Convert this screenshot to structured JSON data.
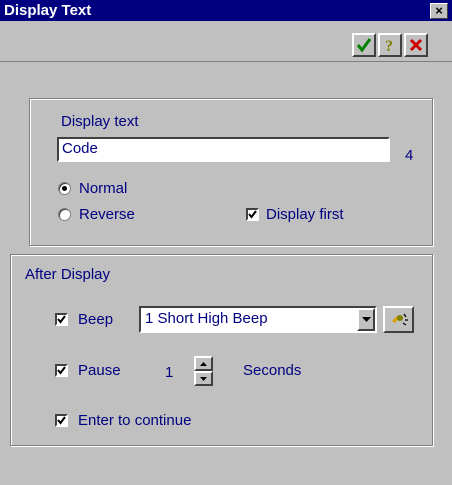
{
  "window": {
    "title": "Display Text",
    "close_glyph": "×"
  },
  "toolbar": {
    "ok_icon": "checkmark-icon",
    "help_icon": "question-icon",
    "cancel_icon": "red-x-icon",
    "colors": {
      "ok": "#008000",
      "help": "#808000",
      "cancel": "#cc0000"
    }
  },
  "display_group": {
    "label": "Display text",
    "text_value": "Code",
    "char_count": "4",
    "radio_normal": "Normal",
    "radio_reverse": "Reverse",
    "selected": "Normal",
    "display_first_label": "Display first",
    "display_first_checked": true
  },
  "after_display": {
    "group_label": "After Display",
    "beep": {
      "label": "Beep",
      "checked": true,
      "value": "1 Short High Beep",
      "test_icon": "beep-test-icon"
    },
    "pause": {
      "label": "Pause",
      "checked": true,
      "value": "1",
      "unit": "Seconds"
    },
    "enter": {
      "label": "Enter to continue",
      "checked": true
    }
  }
}
